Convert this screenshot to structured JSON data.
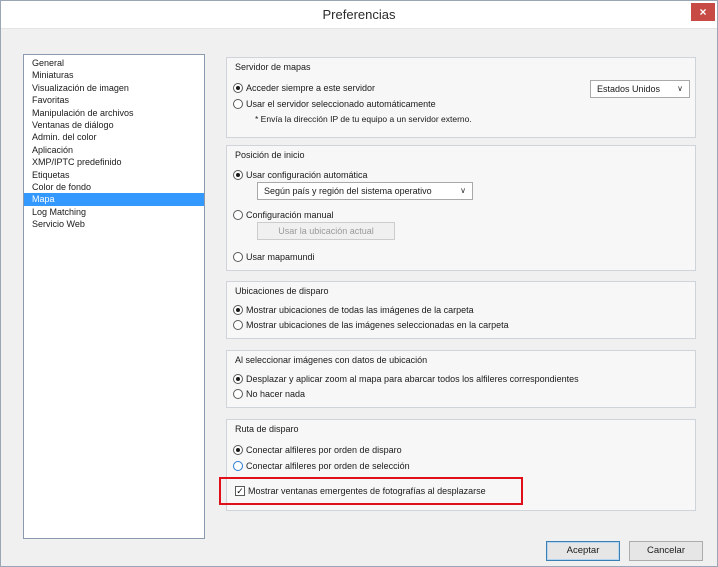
{
  "window": {
    "title": "Preferencias",
    "close_glyph": "×"
  },
  "sidebar": {
    "items": [
      {
        "label": "General",
        "selected": false
      },
      {
        "label": "Miniaturas",
        "selected": false
      },
      {
        "label": "Visualización de imagen",
        "selected": false
      },
      {
        "label": "Favoritas",
        "selected": false
      },
      {
        "label": "Manipulación de archivos",
        "selected": false
      },
      {
        "label": "Ventanas de diálogo",
        "selected": false
      },
      {
        "label": "Admin. del color",
        "selected": false
      },
      {
        "label": "Aplicación",
        "selected": false
      },
      {
        "label": "XMP/IPTC predefinido",
        "selected": false
      },
      {
        "label": "Etiquetas",
        "selected": false
      },
      {
        "label": "Color de fondo",
        "selected": false
      },
      {
        "label": "Mapa",
        "selected": true
      },
      {
        "label": "Log Matching",
        "selected": false
      },
      {
        "label": "Servicio Web",
        "selected": false
      }
    ],
    "selected_color": "#3399ff"
  },
  "map_server": {
    "title": "Servidor de mapas",
    "opt_always": "Acceder siempre a este servidor",
    "opt_auto": "Usar el servidor seleccionado automáticamente",
    "note": "* Envía la dirección IP de tu equipo a un servidor externo.",
    "server_select": "Estados Unidos",
    "selected_option": "opt_always"
  },
  "start_position": {
    "title": "Posición de inicio",
    "opt_auto": "Usar configuración automática",
    "auto_select": "Según país y región del sistema operativo",
    "opt_manual": "Configuración manual",
    "use_current_button": "Usar la ubicación actual",
    "opt_world": "Usar mapamundi",
    "selected_option": "opt_auto"
  },
  "shot_locations": {
    "title": "Ubicaciones de disparo",
    "opt_all": "Mostrar ubicaciones de todas las imágenes de la carpeta",
    "opt_selected": "Mostrar ubicaciones de las imágenes seleccionadas en la carpeta",
    "selected_option": "opt_all"
  },
  "location_select": {
    "title": "Al seleccionar imágenes con datos de ubicación",
    "opt_pan": "Desplazar y aplicar zoom al mapa para abarcar todos los alfileres correspondientes",
    "opt_nothing": "No hacer nada",
    "selected_option": "opt_pan"
  },
  "shot_route": {
    "title": "Ruta de disparo",
    "opt_by_shot": "Conectar alfileres por orden de disparo",
    "opt_by_selection": "Conectar alfileres por orden de selección",
    "show_popups": "Mostrar ventanas emergentes de fotografías al desplazarse",
    "show_popups_checked": true,
    "selected_option": "opt_by_shot"
  },
  "footer": {
    "ok_label": "Aceptar",
    "cancel_label": "Cancelar"
  },
  "colors": {
    "highlight": "#e0101a",
    "close_button": "#c74a44"
  },
  "icons": {
    "close": "close-icon",
    "chevron": "chevron-down-icon",
    "checkmark": "checkmark-icon"
  }
}
